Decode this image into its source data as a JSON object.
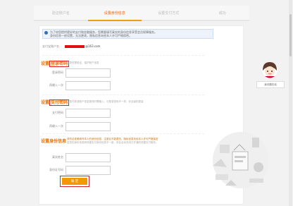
{
  "tabs": [
    {
      "label": "验证账户名"
    },
    {
      "label": "设置身份信息"
    },
    {
      "label": "设置支付方式"
    },
    {
      "label": "成功"
    }
  ],
  "notice": {
    "line1": "为了给您提供更好的支付和金融服务，您需要填写真实的身份信息享受会员保障服务。",
    "line2": "身份信息一经设置，无法更改，隐私信息未经本人许可严格保密。"
  },
  "account": {
    "label": "支付宝账户名",
    "value": "@163.com"
  },
  "login_section": {
    "title_prefix": "设置",
    "title_highlight": "登录密码",
    "hint": "登录时需验证，保护账户信息",
    "field1": "登录密码",
    "field2": "再输入一次"
  },
  "pay_section": {
    "title_prefix": "设置",
    "title_highlight": "支付密码",
    "hint": "交易付款或账户信息更改时需输入，与登录密码不一样，安全级别更高",
    "field1": "支付密码",
    "field2": "再输入一次"
  },
  "identity_section": {
    "title": "设置身份信息",
    "hint1": "请务必准确填写本人的身份信息，注册后不能更改，隐私信息未经本人许可严格保密",
    "hint2": "若您的身份信息和快捷支付身份信息不一致，将会自动关闭已开通的快捷支付服务。",
    "field1": "真实姓名",
    "field2": "身份证号码"
  },
  "confirm_label": "确 定",
  "assistant_label": "我问题在线",
  "colors": {
    "accent": "#f39800",
    "title": "#f07000",
    "highlight_border": "#dd2222",
    "mask": "#dd1111"
  }
}
